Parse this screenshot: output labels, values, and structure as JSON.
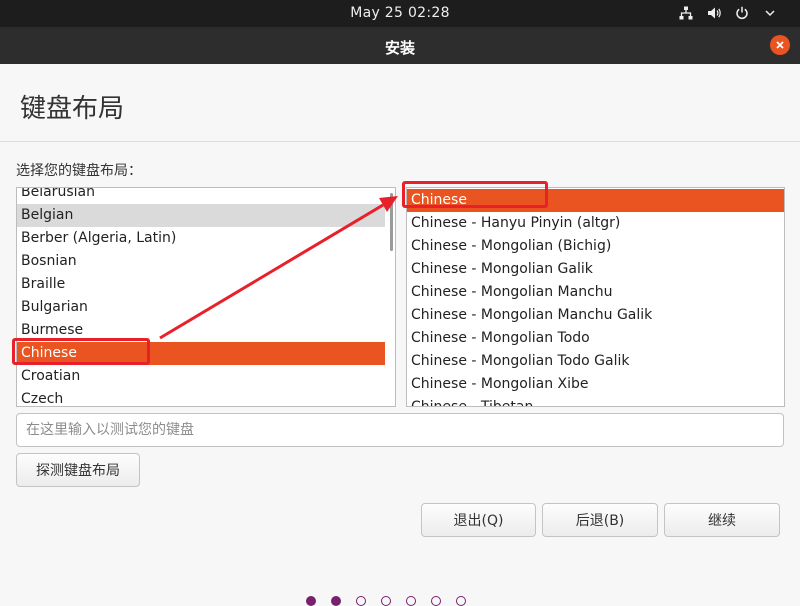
{
  "top_bar": {
    "datetime": "May 25  02:28",
    "tray_icons": [
      "network-icon",
      "volume-icon",
      "power-icon",
      "chevron-down-icon"
    ]
  },
  "window": {
    "title": "安装"
  },
  "page": {
    "title": "键盘布局",
    "prompt": "选择您的键盘布局："
  },
  "layouts": {
    "items": [
      "Belarusian",
      "Belgian",
      "Berber (Algeria, Latin)",
      "Bosnian",
      "Braille",
      "Bulgarian",
      "Burmese",
      "Chinese",
      "Croatian",
      "Czech"
    ],
    "selected": "Chinese",
    "hovered": "Belgian"
  },
  "variants": {
    "items": [
      "Chinese",
      "Chinese - Hanyu Pinyin (altgr)",
      "Chinese - Mongolian (Bichig)",
      "Chinese - Mongolian Galik",
      "Chinese - Mongolian Manchu",
      "Chinese - Mongolian Manchu Galik",
      "Chinese - Mongolian Todo",
      "Chinese - Mongolian Todo Galik",
      "Chinese - Mongolian Xibe",
      "Chinese - Tibetan"
    ],
    "selected": "Chinese"
  },
  "test_field": {
    "placeholder": "在这里输入以测试您的键盘",
    "value": ""
  },
  "buttons": {
    "detect": "探测键盘布局",
    "quit": "退出(Q)",
    "back": "后退(B)",
    "continue": "继续"
  },
  "progress": {
    "total_steps": 7,
    "completed_steps": 2
  },
  "colors": {
    "accent": "#e95420",
    "progress_dot": "#77216f",
    "annotation": "#e8202a"
  }
}
